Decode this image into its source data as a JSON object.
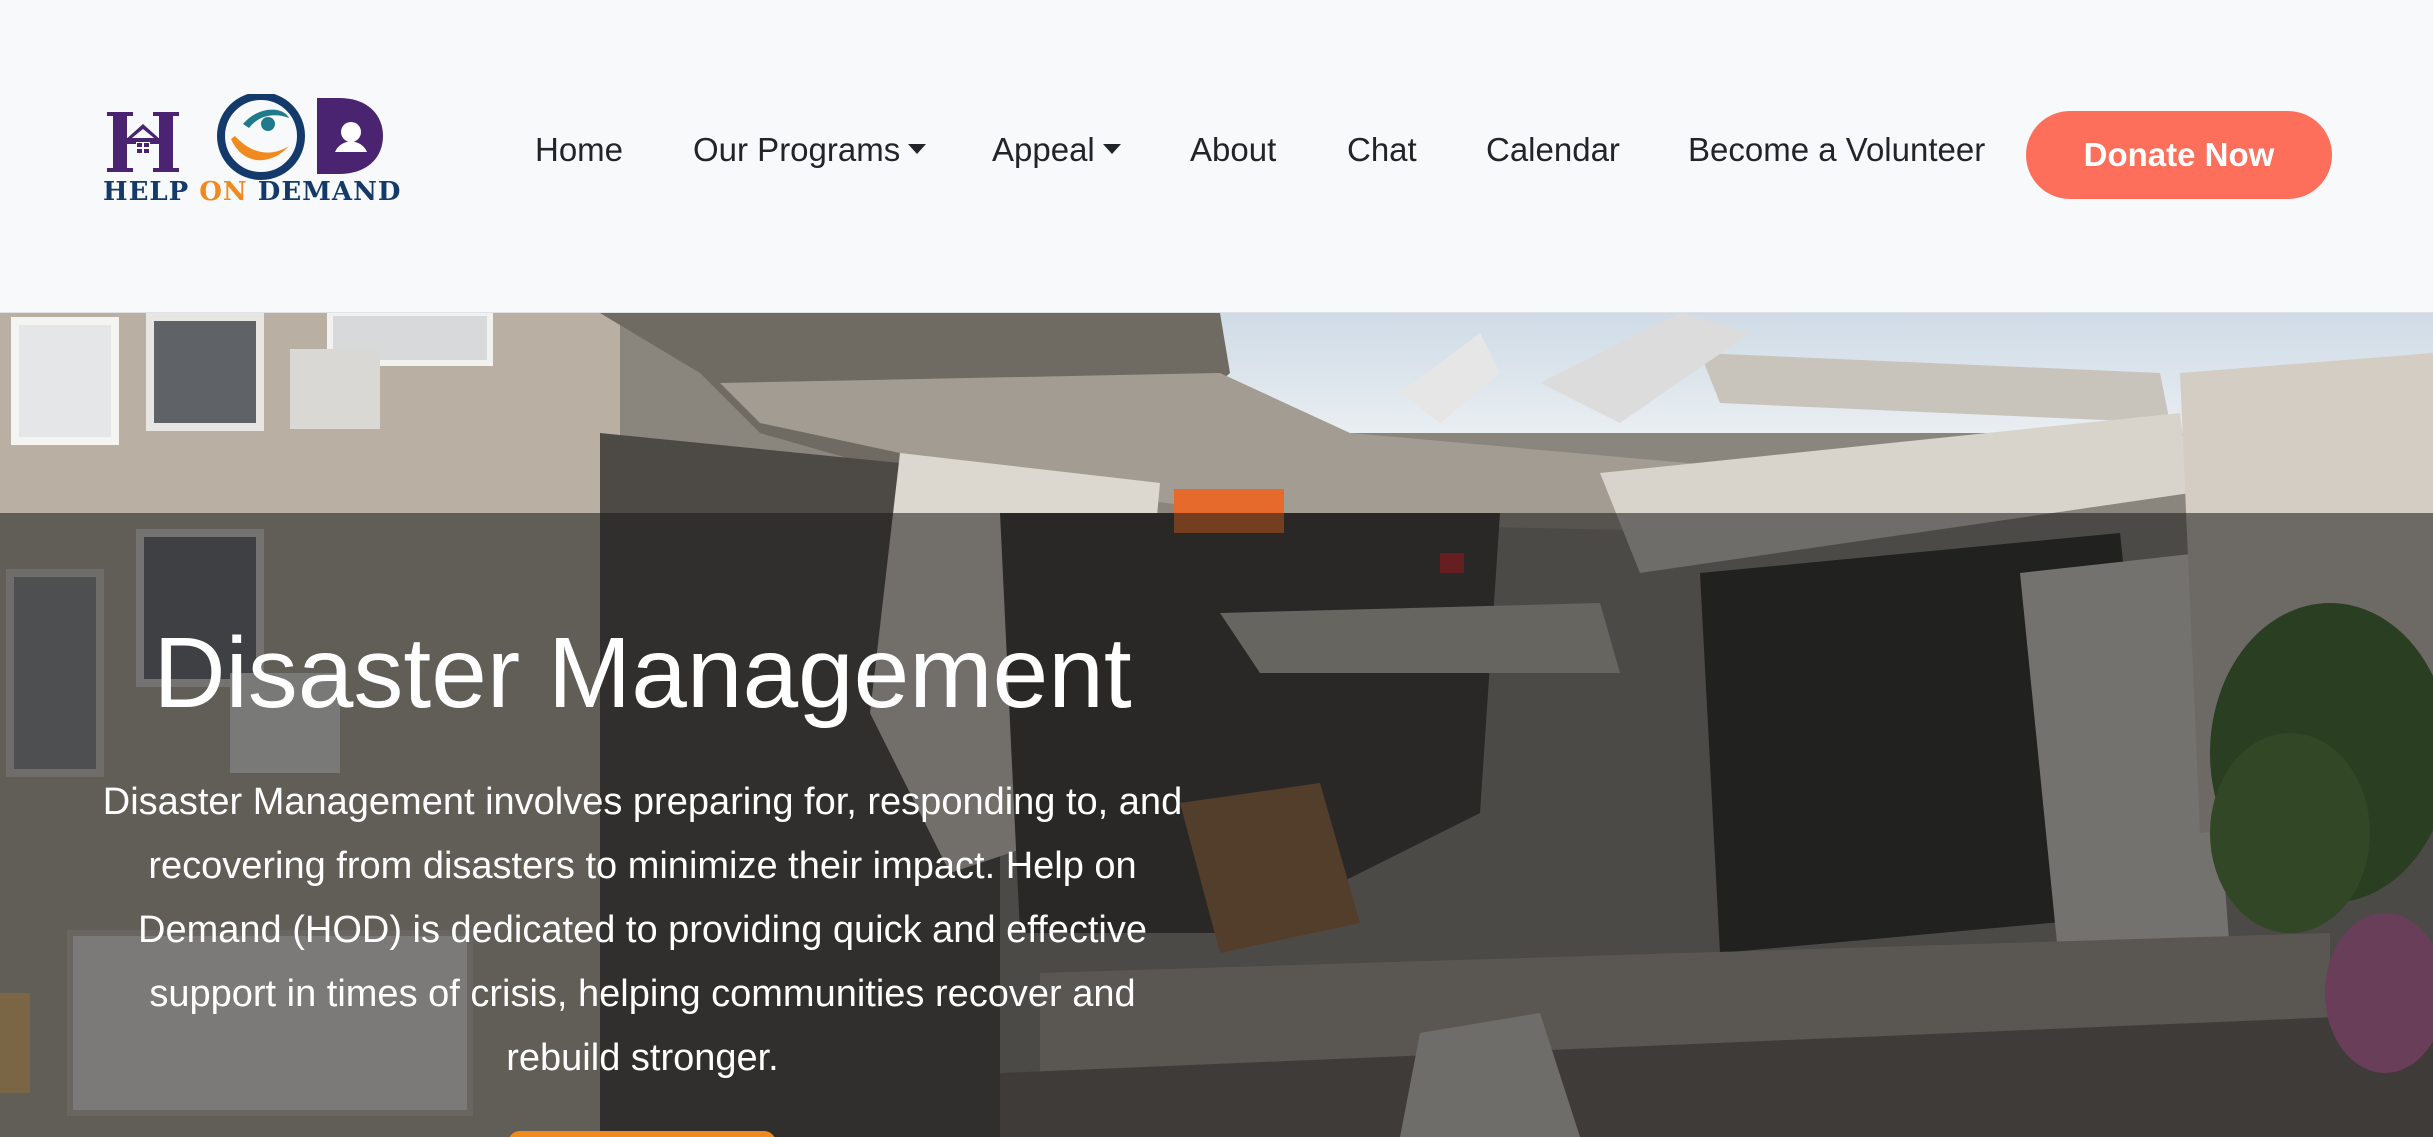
{
  "brand": {
    "logo_text_help": "HELP",
    "logo_text_on": "ON",
    "logo_text_demand": "DEMAND",
    "colors": {
      "purple": "#4a2470",
      "orange": "#f08a1e",
      "navy": "#143a6b"
    }
  },
  "nav": {
    "items": [
      {
        "label": "Home",
        "dropdown": false
      },
      {
        "label": "Our Programs",
        "dropdown": true
      },
      {
        "label": "Appeal",
        "dropdown": true
      },
      {
        "label": "About",
        "dropdown": false
      },
      {
        "label": "Chat",
        "dropdown": false
      },
      {
        "label": "Calendar",
        "dropdown": false
      },
      {
        "label": "Become a Volunteer",
        "dropdown": false
      }
    ],
    "donate_label": "Donate Now",
    "donate_color": "#fd6e5b"
  },
  "hero": {
    "title": "Disaster Management",
    "description": "Disaster Management involves preparing for, responding to, and recovering from disasters to minimize their impact. Help on Demand (HOD) is dedicated to providing quick and effective support in times of crisis, helping communities recover and rebuild stronger.",
    "image_alt": "collapsed-building-photo",
    "button_color": "#f08a1e"
  }
}
